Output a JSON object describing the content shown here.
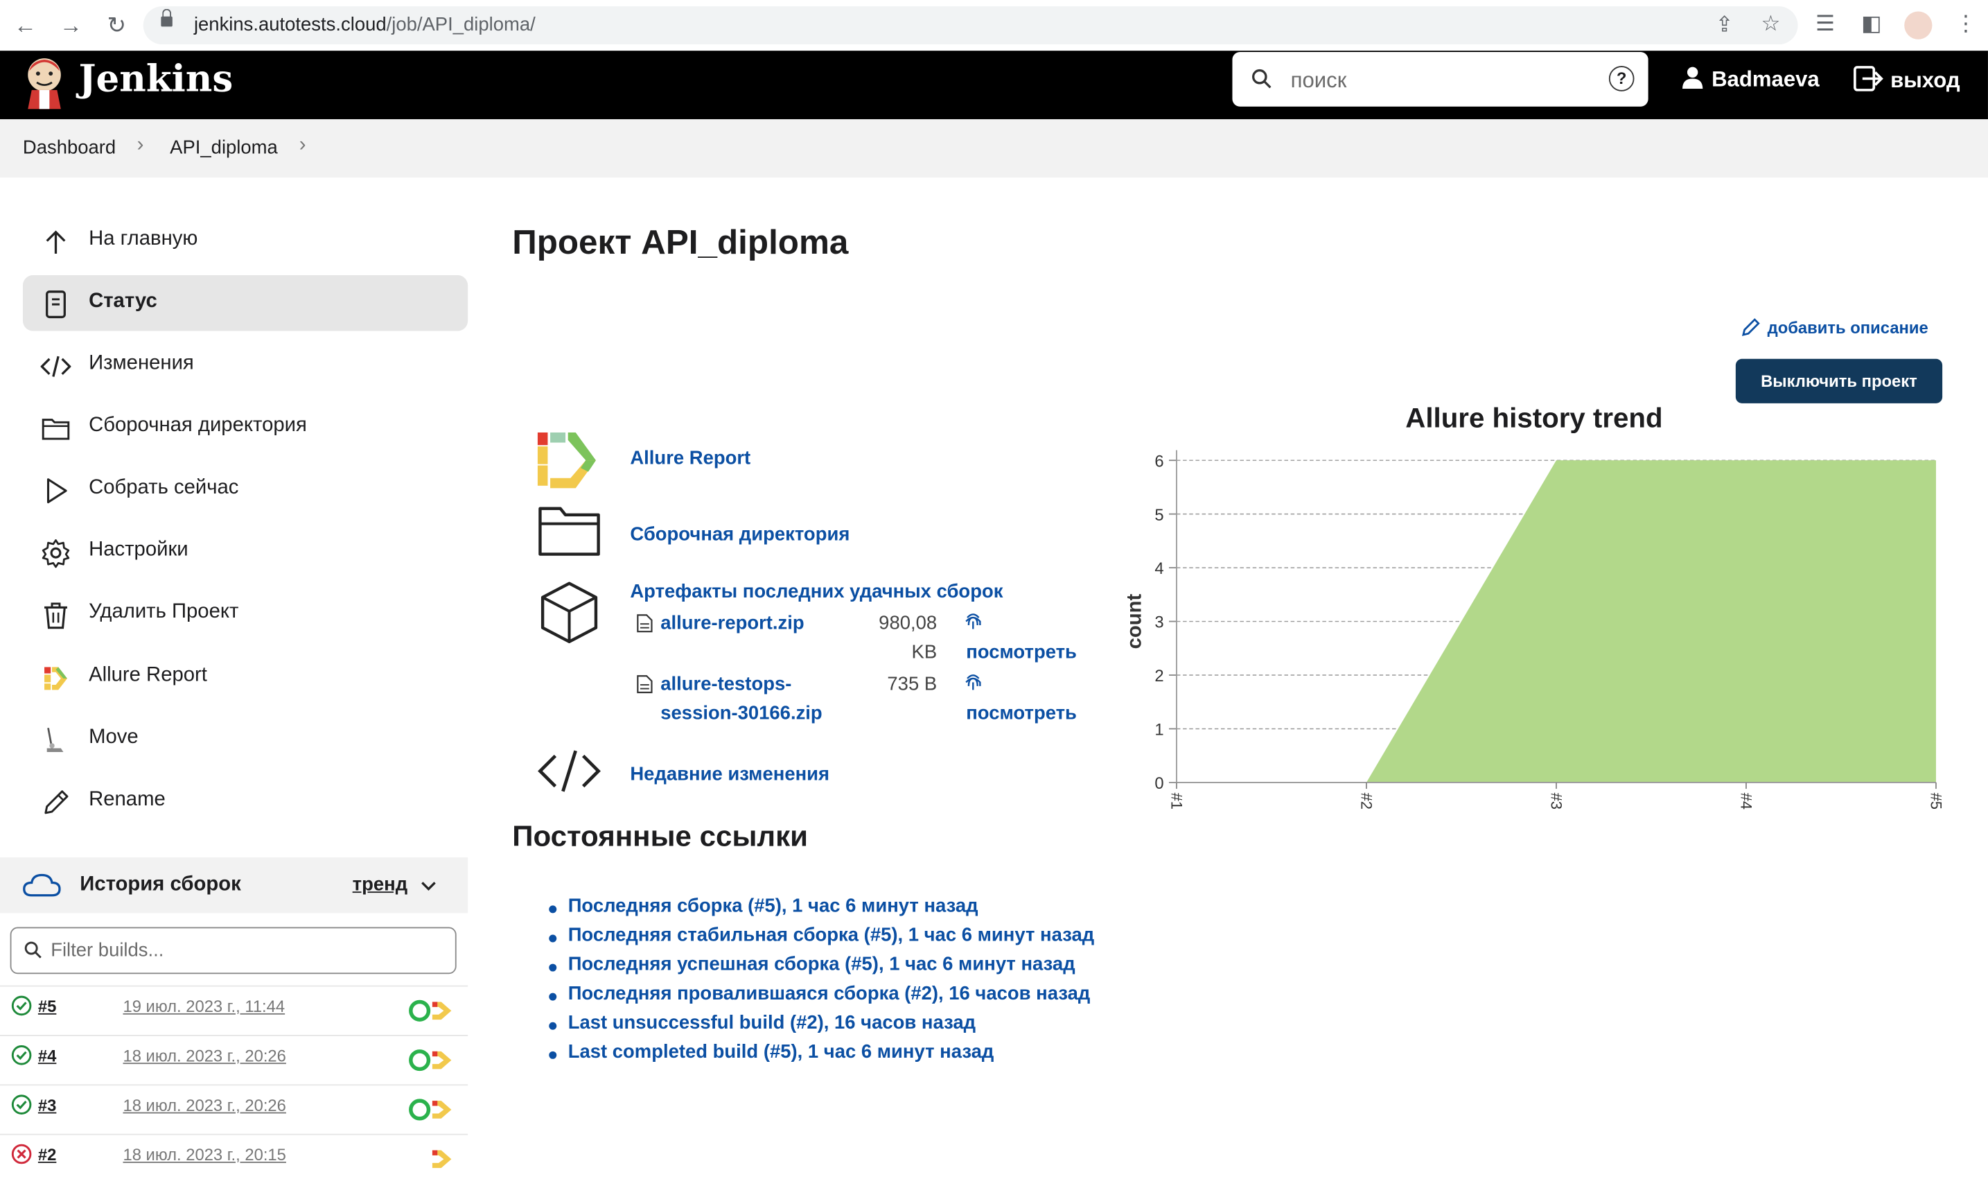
{
  "browser": {
    "url_host": "jenkins.autotests.cloud",
    "url_path": "/job/API_diploma/"
  },
  "header": {
    "brand": "Jenkins",
    "search_placeholder": "поиск",
    "user": "Badmaeva",
    "logout": "выход"
  },
  "breadcrumb": [
    "Dashboard",
    "API_diploma"
  ],
  "sidebar": {
    "items": [
      {
        "label": "На главную",
        "icon": "arrow-up-icon"
      },
      {
        "label": "Статус",
        "icon": "document-icon",
        "active": true
      },
      {
        "label": "Изменения",
        "icon": "code-icon"
      },
      {
        "label": "Сборочная директория",
        "icon": "folder-icon"
      },
      {
        "label": "Собрать сейчас",
        "icon": "play-icon"
      },
      {
        "label": "Настройки",
        "icon": "gear-icon"
      },
      {
        "label": "Удалить Проект",
        "icon": "trash-icon"
      },
      {
        "label": "Allure Report",
        "icon": "allure-icon"
      },
      {
        "label": "Move",
        "icon": "move-icon"
      },
      {
        "label": "Rename",
        "icon": "pencil-icon"
      }
    ]
  },
  "build_history": {
    "title": "История сборок",
    "trend": "тренд",
    "filter_placeholder": "Filter builds...",
    "builds": [
      {
        "num": "#5",
        "date": "19 июл. 2023 г., 11:44",
        "status": "success"
      },
      {
        "num": "#4",
        "date": "18 июл. 2023 г., 20:26",
        "status": "success"
      },
      {
        "num": "#3",
        "date": "18 июл. 2023 г., 20:26",
        "status": "success"
      },
      {
        "num": "#2",
        "date": "18 июл. 2023 г., 20:15",
        "status": "failed"
      }
    ]
  },
  "main": {
    "title": "Проект API_diploma",
    "add_description": "добавить описание",
    "disable_button": "Выключить проект",
    "allure_report": "Allure Report",
    "workspace": "Сборочная директория",
    "artifacts_title": "Артефакты последних удачных сборок",
    "artifacts": [
      {
        "name_line1": "allure-report.zip",
        "name_line2": "",
        "size_line1": "980,08",
        "size_line2": "KB",
        "view": "посмотреть"
      },
      {
        "name_line1": "allure-testops-",
        "name_line2": "session-30166.zip",
        "size_line1": "735 B",
        "size_line2": "",
        "view": "посмотреть"
      }
    ],
    "recent_changes": "Недавние изменения",
    "permalinks_title": "Постоянные ссылки",
    "permalinks": [
      "Последняя сборка (#5), 1 час 6 минут назад",
      "Последняя стабильная сборка (#5), 1 час 6 минут назад",
      "Последняя успешная сборка (#5), 1 час 6 минут назад",
      "Последняя провалившаяся сборка (#2), 16 часов назад",
      "Last unsuccessful build (#2), 16 часов назад",
      "Last completed build (#5), 1 час 6 минут назад"
    ]
  },
  "colors": {
    "header_bg": "#000000",
    "link": "#0b4fa3",
    "button_bg": "#12395b",
    "chart_fill": "#b2d88a",
    "success": "#1e8a3a",
    "failed": "#d0283a"
  },
  "chart_data": {
    "type": "area",
    "title": "Allure history trend",
    "ylabel": "count",
    "xlabel": "",
    "x": [
      "#1",
      "#2",
      "#3",
      "#4",
      "#5"
    ],
    "series": [
      {
        "values": [
          0,
          0,
          6,
          6,
          6
        ]
      }
    ],
    "ylim": [
      0,
      6
    ],
    "yticks": [
      0,
      1,
      2,
      3,
      4,
      5,
      6
    ],
    "grid": true
  }
}
